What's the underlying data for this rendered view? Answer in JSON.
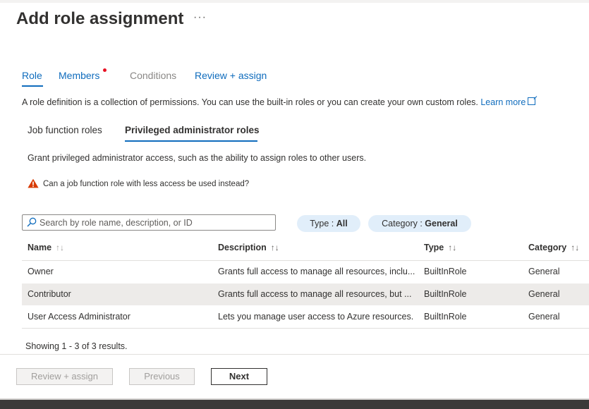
{
  "header": {
    "title": "Add role assignment",
    "more": "···"
  },
  "tabs": [
    {
      "label": "Role"
    },
    {
      "label": "Members"
    },
    {
      "label": "Conditions"
    },
    {
      "label": "Review + assign"
    }
  ],
  "description": {
    "text": "A role definition is a collection of permissions. You can use the built-in roles or you can create your own custom roles. ",
    "link": "Learn more"
  },
  "subtabs": [
    {
      "label": "Job function roles"
    },
    {
      "label": "Privileged administrator roles"
    }
  ],
  "grant_text": "Grant privileged administrator access, such as the ability to assign roles to other users.",
  "warning_text": "Can a job function role with less access be used instead?",
  "search": {
    "placeholder": "Search by role name, description, or ID",
    "value": ""
  },
  "filters": {
    "type": {
      "label": "Type : ",
      "value": "All"
    },
    "category": {
      "label": "Category : ",
      "value": "General"
    }
  },
  "table": {
    "columns": [
      "Name",
      "Description",
      "Type",
      "Category"
    ],
    "rows": [
      {
        "name": "Owner",
        "description": "Grants full access to manage all resources, inclu...",
        "type": "BuiltInRole",
        "category": "General"
      },
      {
        "name": "Contributor",
        "description": "Grants full access to manage all resources, but ...",
        "type": "BuiltInRole",
        "category": "General"
      },
      {
        "name": "User Access Administrator",
        "description": "Lets you manage user access to Azure resources.",
        "type": "BuiltInRole",
        "category": "General"
      }
    ]
  },
  "status": {
    "showing": "Showing 1 - 3 of 3 results."
  },
  "buttons": {
    "review": "Review + assign",
    "previous": "Previous",
    "next": "Next"
  },
  "colors": {
    "accent": "#0f6cbd",
    "warning": "#d83b01",
    "pill_bg": "#e1eefa",
    "notification_dot": "#e81123"
  }
}
